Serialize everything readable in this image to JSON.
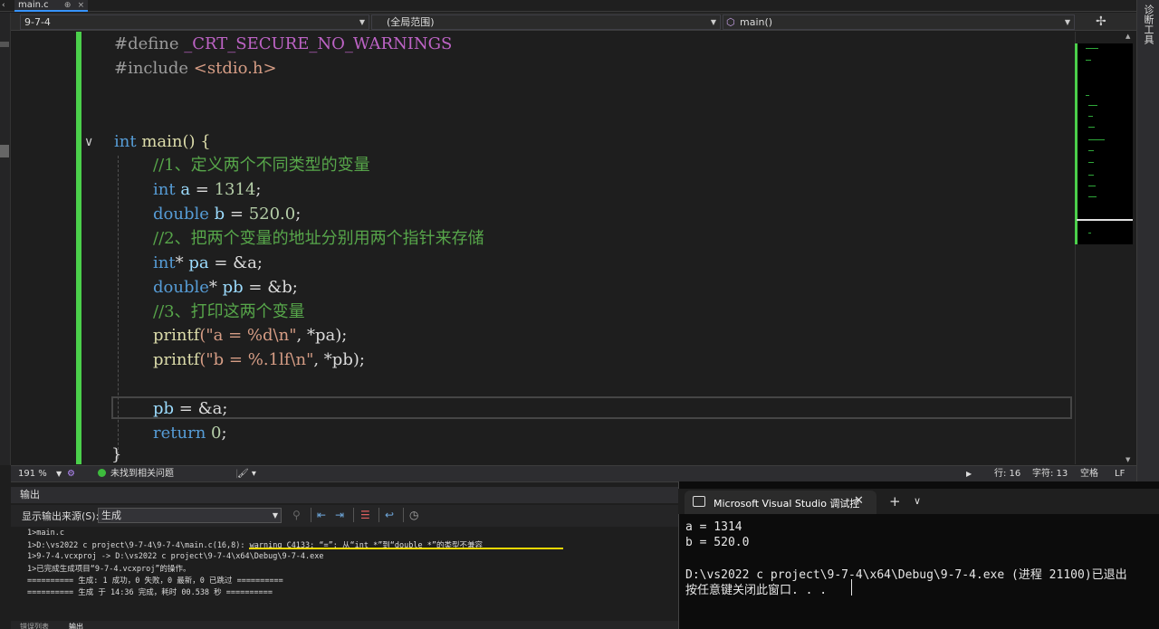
{
  "tab": {
    "name": "main.c",
    "pin": "⊕",
    "close": "×"
  },
  "nav": {
    "project": "9-7-4",
    "scope": "(全局范围)",
    "func": "main()"
  },
  "code": {
    "l1_dir": "#define",
    "l1_mac": "_CRT_SECURE_NO_WARNINGS",
    "l2_dir": "#include",
    "l2_hdr": "<stdio.h>",
    "l5_type": "int",
    "l5_rest": "main() {",
    "l6": "//1、定义两个不同类型的变量",
    "l7_type": "int",
    "l7_var": "a",
    "l7_eq": " = ",
    "l7_num": "1314",
    "l7_end": ";",
    "l8_type": "double",
    "l8_var": "b",
    "l8_eq": " = ",
    "l8_num": "520.0",
    "l8_end": ";",
    "l9": "//2、把两个变量的地址分别用两个指针来存储",
    "l10_type": "int",
    "l10_star": "*",
    "l10_var": "pa",
    "l10_rest": " = &a;",
    "l11_type": "double",
    "l11_star": "*",
    "l11_var": "pb",
    "l11_rest": " = &b;",
    "l12": "//3、打印这两个变量",
    "l13_fn": "printf",
    "l13_str": "(\"a = %d\\n\"",
    "l13_rest": ", *pa);",
    "l14_fn": "printf",
    "l14_str": "(\"b = %.1lf\\n\"",
    "l14_rest": ", *pb);",
    "l16_var": "pb",
    "l16_rest": " = &a;",
    "l17_kw": "return",
    "l17_num": "0",
    "l17_end": ";",
    "l18": "}"
  },
  "status": {
    "zoom": "191 %",
    "issues": "未找到相关问题",
    "line": "行: 16",
    "char": "字符: 13",
    "ws": "空格",
    "eol": "LF"
  },
  "output": {
    "title": "输出",
    "source_label": "显示输出来源(S):",
    "source_value": "生成",
    "lines": [
      "1>main.c",
      "1>D:\\vs2022 c project\\9-7-4\\9-7-4\\main.c(16,8): warning C4133: “=”: 从“int *”到“double *”的类型不兼容",
      "1>9-7-4.vcxproj -> D:\\vs2022 c project\\9-7-4\\x64\\Debug\\9-7-4.exe",
      "1>已完成生成项目“9-7-4.vcxproj”的操作。",
      "========== 生成: 1 成功，0 失败，0 最新，0 已跳过 ==========",
      "========== 生成 于 14:36 完成，耗时 00.538 秒 =========="
    ],
    "bottom_tabs": [
      "错误列表",
      "输出"
    ]
  },
  "console": {
    "title": "Microsoft Visual Studio 调试控",
    "lines": [
      "a = 1314",
      "b = 520.0",
      "",
      "D:\\vs2022 c project\\9-7-4\\x64\\Debug\\9-7-4.exe (进程 21100)已退出",
      "按任意键关闭此窗口. . ."
    ]
  },
  "side_tool": "诊断工具",
  "colors": {
    "change_bar": "#4bd04b",
    "highlight": "#f0d800",
    "keyword": "#569cd6",
    "comment": "#57a64a"
  }
}
